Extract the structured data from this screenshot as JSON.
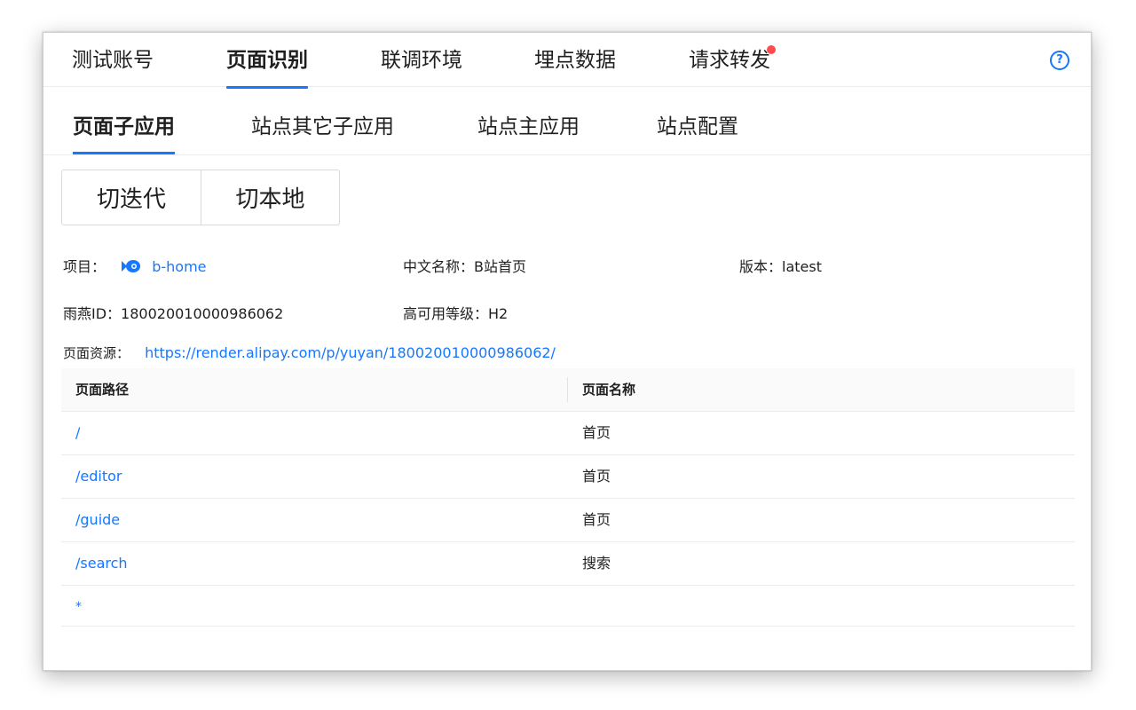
{
  "top_tabs": [
    {
      "label": "测试账号",
      "active": false
    },
    {
      "label": "页面识别",
      "active": true
    },
    {
      "label": "联调环境",
      "active": false
    },
    {
      "label": "埋点数据",
      "active": false
    },
    {
      "label": "请求转发",
      "active": false,
      "badge_dot": true
    }
  ],
  "help_icon": "question-circle-icon",
  "help_glyph": "?",
  "sub_tabs": [
    {
      "label": "页面子应用",
      "active": true
    },
    {
      "label": "站点其它子应用",
      "active": false
    },
    {
      "label": "站点主应用",
      "active": false
    },
    {
      "label": "站点配置",
      "active": false
    }
  ],
  "buttons": {
    "switch_iteration": "切迭代",
    "switch_local": "切本地"
  },
  "info": {
    "project_label": "项目：",
    "project_value": "b-home",
    "chinese_name_label": "中文名称：",
    "chinese_name_value": "B站首页",
    "version_label": "版本：",
    "version_value": "latest",
    "yuyan_id_label": "雨燕ID：",
    "yuyan_id_value": "18002001000098606​2",
    "availability_label": "高可用等级：",
    "availability_value": "H2",
    "page_resource_label": "页面资源：",
    "page_resource_value": "https://render.alipay.com/p/yuyan/180020010000986062/"
  },
  "table": {
    "headers": [
      "页面路径",
      "页面名称"
    ],
    "rows": [
      {
        "path": "/",
        "name": "首页"
      },
      {
        "path": "/editor",
        "name": "首页"
      },
      {
        "path": "/guide",
        "name": "首页"
      },
      {
        "path": "/search",
        "name": "搜索"
      },
      {
        "path": "*",
        "name": ""
      }
    ]
  },
  "colors": {
    "accent": "#1677ff",
    "badge": "#ff4d4f"
  }
}
